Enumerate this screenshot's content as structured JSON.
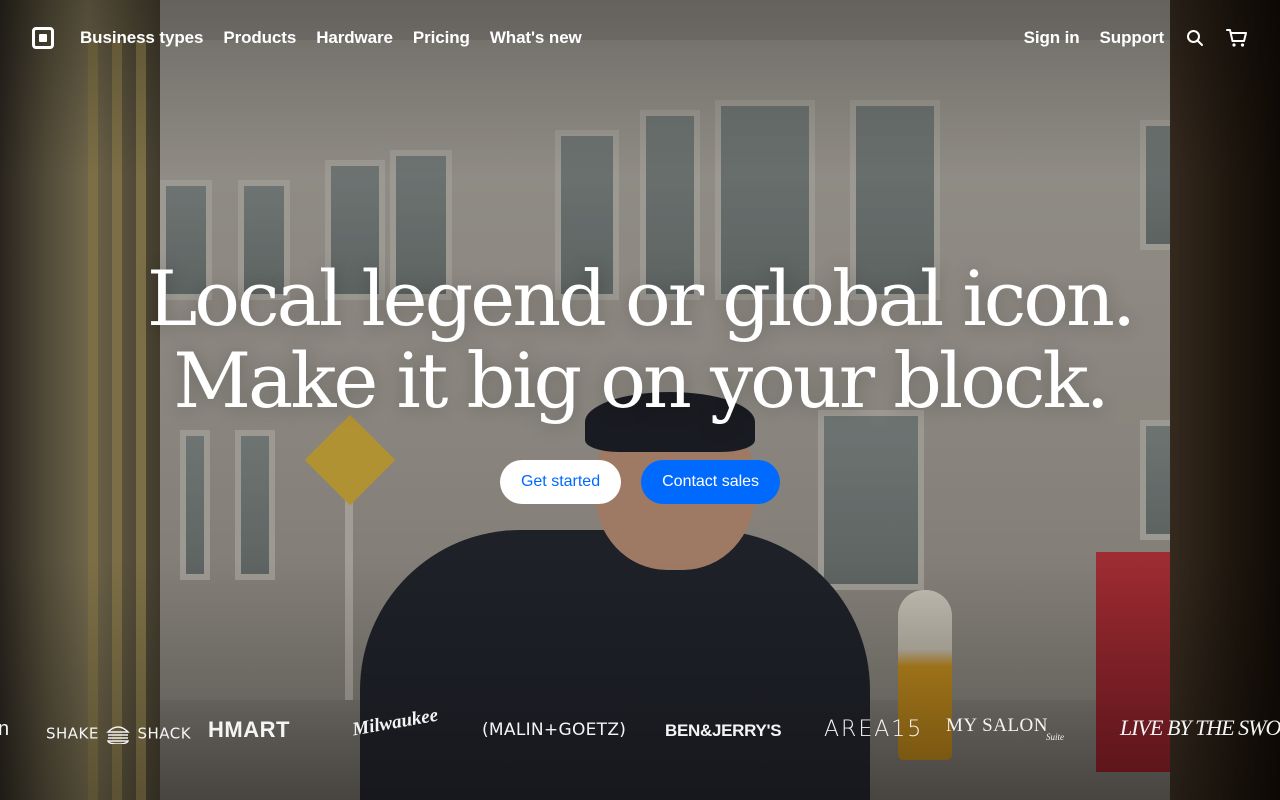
{
  "nav": {
    "logo_name": "Square",
    "links": [
      "Business types",
      "Products",
      "Hardware",
      "Pricing",
      "What's new"
    ],
    "sign_in": "Sign in",
    "support": "Support",
    "icons": [
      "search-icon",
      "cart-icon"
    ]
  },
  "hero": {
    "headline_line1": "Local legend or global icon.",
    "headline_line2": "Make it big on your block.",
    "cta_primary": "Get started",
    "cta_secondary": "Contact sales"
  },
  "logos": {
    "fragment": "n",
    "shake_left": "SHAKE",
    "shake_right": "SHACK",
    "hmart": "HMART",
    "milwaukee": "Milwaukee",
    "malin": "(MALIN+GOETZ)",
    "benjerry": "BEN&JERRY'S",
    "area15": "AREA15",
    "mysalon": "MY SALON",
    "mysalon_sub": "Suite",
    "livebythesword": "LIVE BY THE SWORD"
  },
  "colors": {
    "accent_blue": "#006aff",
    "text": "#ffffff"
  }
}
